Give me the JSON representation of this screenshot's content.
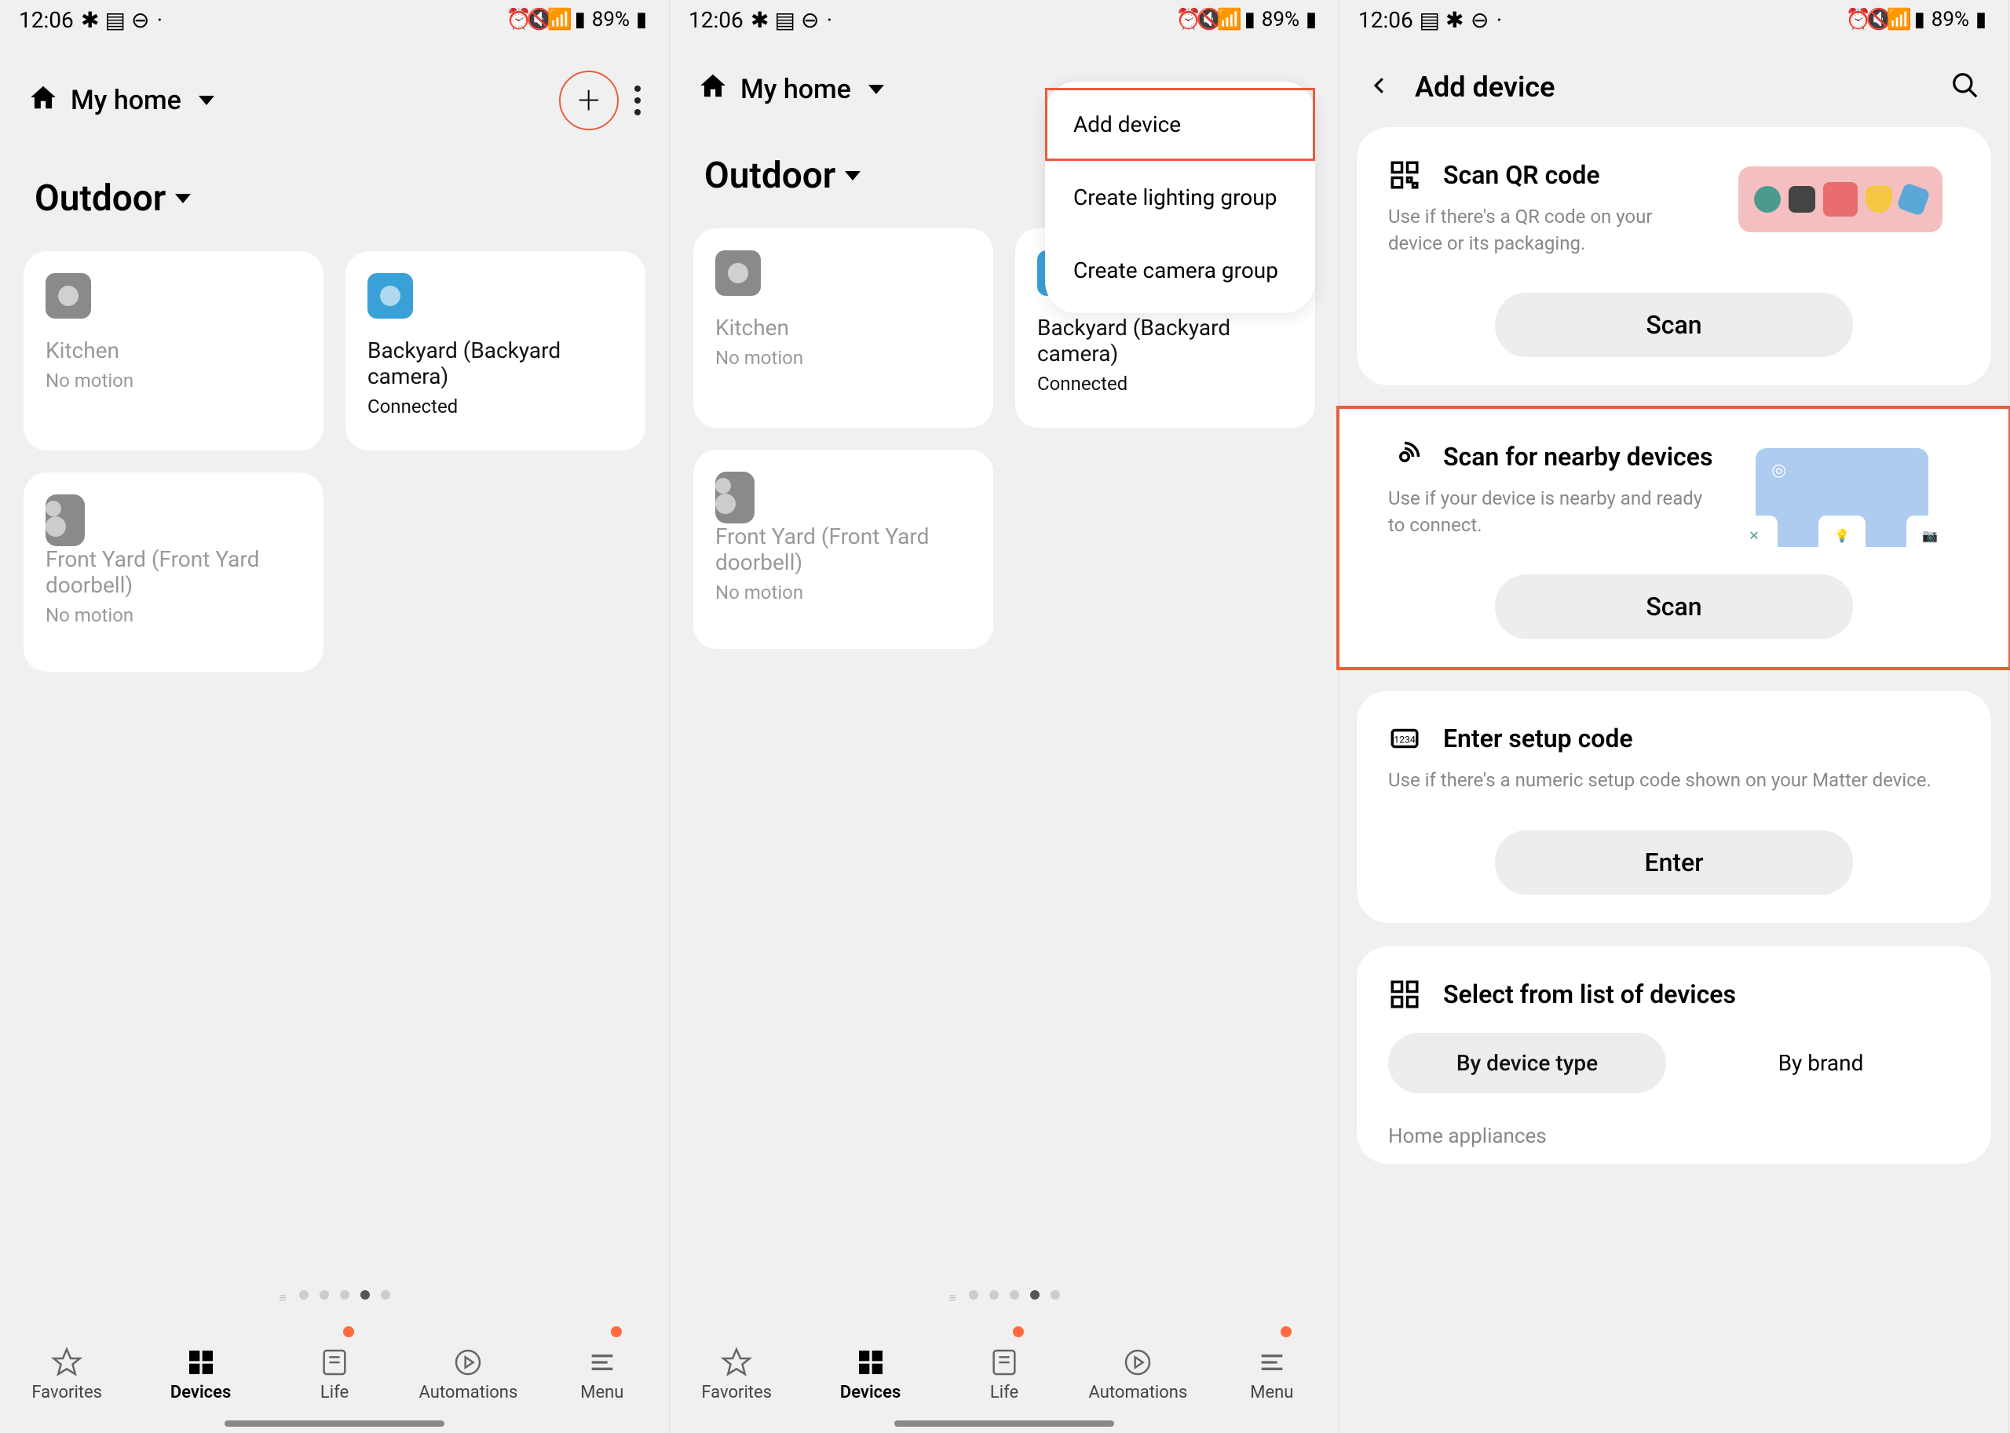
{
  "statusbar": {
    "time": "12:06",
    "battery": "89%"
  },
  "header": {
    "location": "My home"
  },
  "room": "Outdoor",
  "devices": [
    {
      "name": "Kitchen",
      "status": "No motion",
      "muted": true,
      "type": "camera"
    },
    {
      "name": "Backyard (Backyard camera)",
      "status": "Connected",
      "muted": false,
      "type": "camera"
    },
    {
      "name": "Front Yard (Front Yard doorbell)",
      "status": "No motion",
      "muted": true,
      "type": "doorbell"
    }
  ],
  "bottomNav": {
    "favorites": "Favorites",
    "devices": "Devices",
    "life": "Life",
    "automations": "Automations",
    "menu": "Menu"
  },
  "popup": {
    "addDevice": "Add device",
    "lightingGroup": "Create lighting group",
    "cameraGroup": "Create camera group"
  },
  "addDeviceScreen": {
    "title": "Add device",
    "qr": {
      "title": "Scan QR code",
      "desc": "Use if there's a QR code on your device or its packaging.",
      "btn": "Scan"
    },
    "nearby": {
      "title": "Scan for nearby devices",
      "desc": "Use if your device is nearby and ready to connect.",
      "btn": "Scan"
    },
    "setup": {
      "title": "Enter setup code",
      "desc": "Use if there's a numeric setup code shown on your Matter device.",
      "btn": "Enter"
    },
    "select": {
      "title": "Select from list of devices",
      "tabDevice": "By device type",
      "tabBrand": "By brand",
      "section": "Home appliances"
    }
  }
}
